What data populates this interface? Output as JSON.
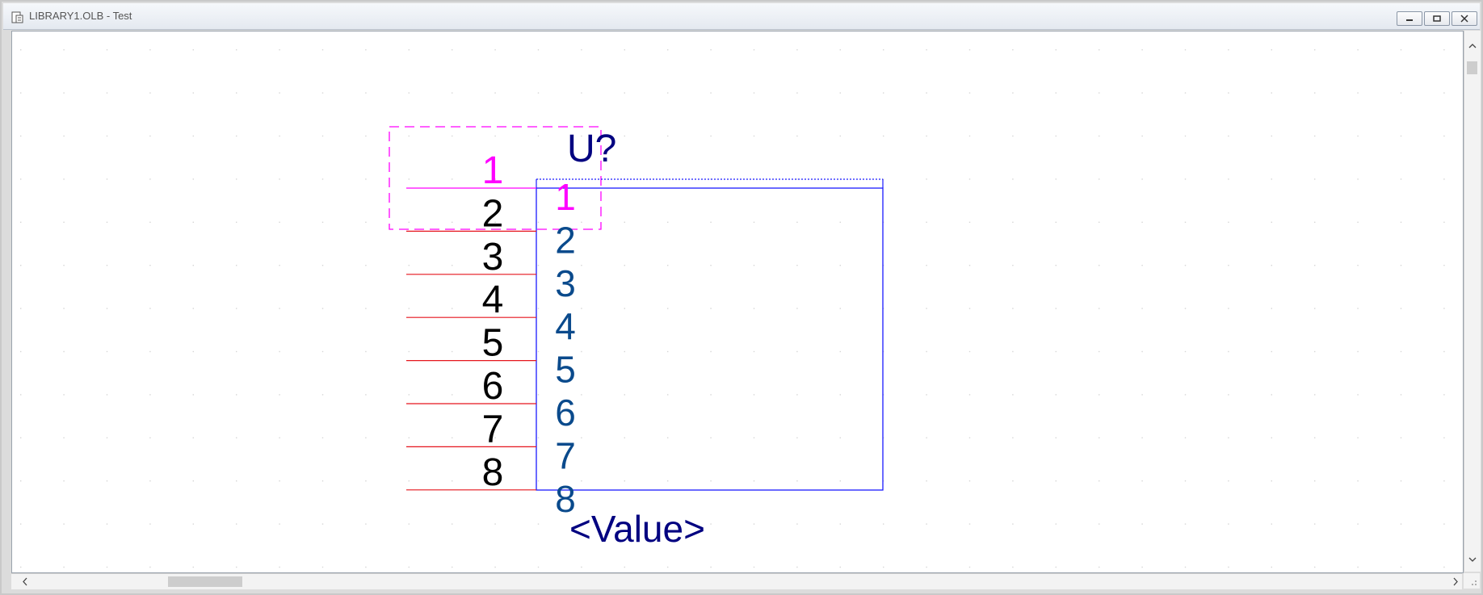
{
  "window": {
    "title": "LIBRARY1.OLB - Test",
    "title_icon": "document-icon",
    "controls": [
      "minimize-icon",
      "restore-icon",
      "close-icon"
    ]
  },
  "part": {
    "reference": "U?",
    "value": "<Value>",
    "pin_numbers": [
      "1",
      "2",
      "3",
      "4",
      "5",
      "6",
      "7",
      "8"
    ],
    "pin_names": [
      "1",
      "2",
      "3",
      "4",
      "5",
      "6",
      "7",
      "8"
    ],
    "selected_pin": "1"
  },
  "colors": {
    "pin_line": "#e5151d",
    "selected": "#ff00ff",
    "body_outline": "#1a1aff",
    "reference_text": "#000080",
    "pin_name_text": "#0a4a8c",
    "pin_number_text": "#000000",
    "grid_dot": "#d6d6d6"
  }
}
